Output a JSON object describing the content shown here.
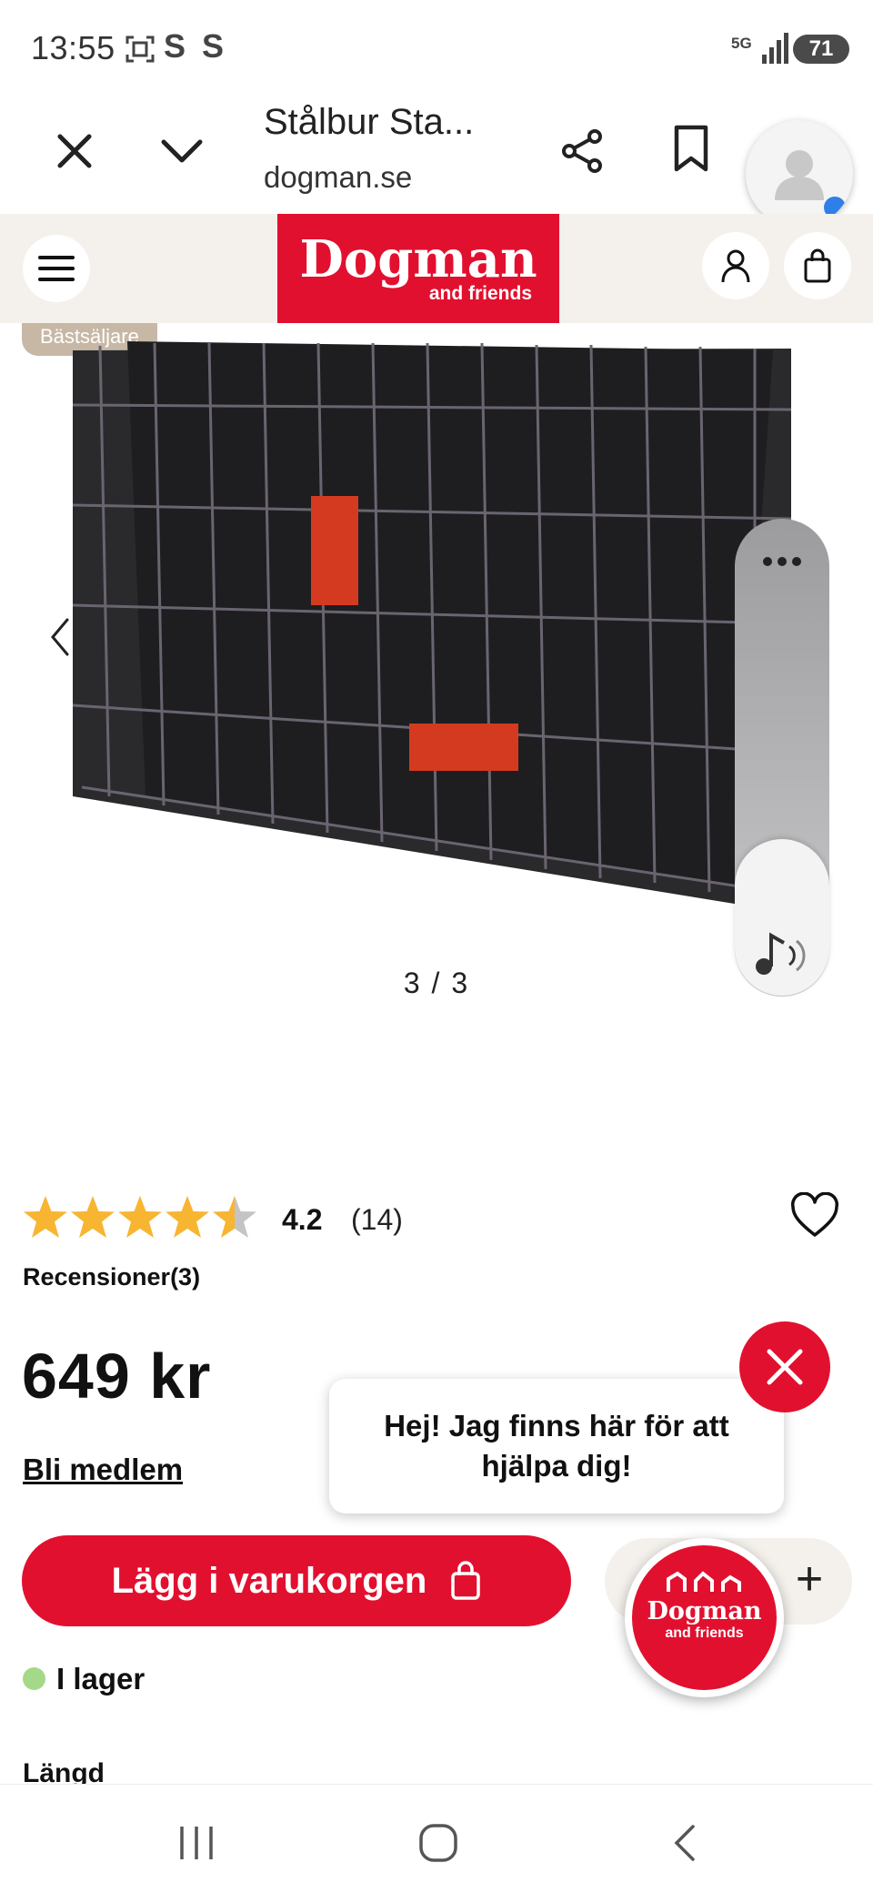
{
  "status_bar": {
    "time": "13:55",
    "network": "5G",
    "battery": "71"
  },
  "browser": {
    "title": "Stålbur Sta...",
    "domain": "dogman.se"
  },
  "logo": {
    "main": "Dogman",
    "sub": "and friends"
  },
  "gallery": {
    "badge": "Bästsäljare",
    "counter": "3 / 3"
  },
  "product": {
    "rating": {
      "value": "4.2",
      "count": "(14)",
      "stars": 4.2
    },
    "reviews_link": "Recensioner(3)",
    "price": "649 kr",
    "member_link": "Bli medlem",
    "add_to_cart": "Lägg i varukorgen",
    "stock": "I lager",
    "length_label": "Längd"
  },
  "chat": {
    "message": "Hej! Jag finns här för att hjälpa dig!",
    "launcher_main": "Dogman",
    "launcher_sub": "and friends"
  },
  "colors": {
    "brand_red": "#e2102f",
    "header_bg": "#f4f1ec",
    "star": "#f7b531",
    "stock_green": "#a4d98a"
  }
}
